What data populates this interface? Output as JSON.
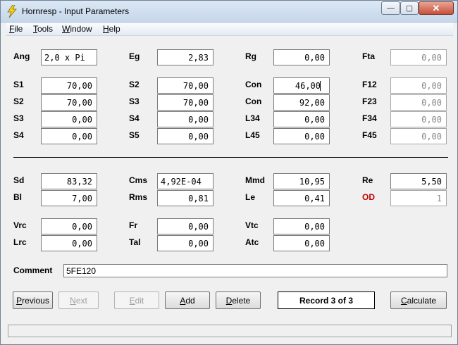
{
  "window": {
    "title": "Hornresp - Input Parameters",
    "min_glyph": "—",
    "max_glyph": "▢",
    "close_glyph": "✕"
  },
  "menu": [
    {
      "key": "F",
      "rest": "ile"
    },
    {
      "key": "T",
      "rest": "ools"
    },
    {
      "key": "W",
      "rest": "indow"
    },
    {
      "key": "H",
      "rest": "elp"
    }
  ],
  "fields": {
    "ang": {
      "label": "Ang",
      "value": "2,0 x Pi"
    },
    "eg": {
      "label": "Eg",
      "value": "2,83"
    },
    "rg": {
      "label": "Rg",
      "value": "0,00"
    },
    "fta": {
      "label": "Fta",
      "value": "0,00"
    },
    "s1": {
      "label": "S1",
      "value": "70,00"
    },
    "s2a": {
      "label": "S2",
      "value": "70,00"
    },
    "con1": {
      "label": "Con",
      "value": "46,00"
    },
    "f12": {
      "label": "F12",
      "value": "0,00"
    },
    "s2b": {
      "label": "S2",
      "value": "70,00"
    },
    "s3a": {
      "label": "S3",
      "value": "70,00"
    },
    "con2": {
      "label": "Con",
      "value": "92,00"
    },
    "f23": {
      "label": "F23",
      "value": "0,00"
    },
    "s3b": {
      "label": "S3",
      "value": "0,00"
    },
    "s4a": {
      "label": "S4",
      "value": "0,00"
    },
    "l34": {
      "label": "L34",
      "value": "0,00"
    },
    "f34": {
      "label": "F34",
      "value": "0,00"
    },
    "s4b": {
      "label": "S4",
      "value": "0,00"
    },
    "s5": {
      "label": "S5",
      "value": "0,00"
    },
    "l45": {
      "label": "L45",
      "value": "0,00"
    },
    "f45": {
      "label": "F45",
      "value": "0,00"
    },
    "sd": {
      "label": "Sd",
      "value": "83,32"
    },
    "cms": {
      "label": "Cms",
      "value": "4,92E-04"
    },
    "mmd": {
      "label": "Mmd",
      "value": "10,95"
    },
    "re": {
      "label": "Re",
      "value": "5,50"
    },
    "bl": {
      "label": "Bl",
      "value": "7,00"
    },
    "rms": {
      "label": "Rms",
      "value": "0,81"
    },
    "le": {
      "label": "Le",
      "value": "0,41"
    },
    "od": {
      "label": "OD",
      "value": "1"
    },
    "vrc": {
      "label": "Vrc",
      "value": "0,00"
    },
    "fr": {
      "label": "Fr",
      "value": "0,00"
    },
    "vtc": {
      "label": "Vtc",
      "value": "0,00"
    },
    "lrc": {
      "label": "Lrc",
      "value": "0,00"
    },
    "tal": {
      "label": "Tal",
      "value": "0,00"
    },
    "atc": {
      "label": "Atc",
      "value": "0,00"
    }
  },
  "comment": {
    "label": "Comment",
    "value": "5FE120"
  },
  "buttons": {
    "previous": {
      "key": "P",
      "rest": "revious"
    },
    "next": {
      "key": "N",
      "rest": "ext"
    },
    "edit": {
      "key": "E",
      "rest": "dit"
    },
    "add": {
      "key": "A",
      "rest": "dd"
    },
    "delete": {
      "key": "D",
      "rest": "elete"
    },
    "calculate": {
      "key": "C",
      "rest": "alculate"
    }
  },
  "record": "Record 3 of 3",
  "colors": {
    "od_label": "#c00000",
    "titlebar": "#c5d7ea",
    "close_button": "#c8503a"
  }
}
